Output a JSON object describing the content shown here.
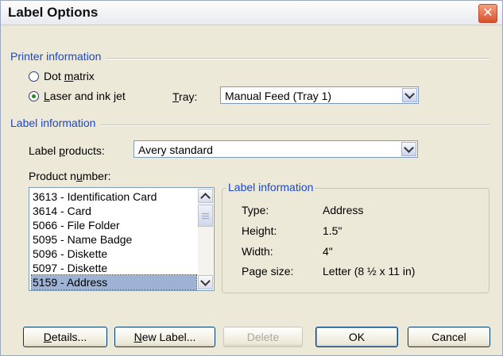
{
  "window": {
    "title": "Label Options",
    "close_glyph": "✕"
  },
  "printer": {
    "section_title": "Printer information",
    "dot_matrix": {
      "prefix": "Dot ",
      "hotkey": "m",
      "suffix": "atrix",
      "selected": false
    },
    "laser": {
      "prefix": "",
      "hotkey": "L",
      "suffix": "aser and ink jet",
      "selected": true
    },
    "tray_label": {
      "prefix": "",
      "hotkey": "T",
      "suffix": "ray:"
    },
    "tray_value": "Manual Feed (Tray 1)"
  },
  "label_info": {
    "section_title": "Label information",
    "products_label": {
      "prefix": "Label ",
      "hotkey": "p",
      "suffix": "roducts:"
    },
    "products_value": "Avery standard",
    "product_number_label": {
      "prefix": "Product n",
      "hotkey": "u",
      "suffix": "mber:"
    },
    "product_numbers": [
      "3613 - Identification Card",
      "3614 - Card",
      "5066 - File Folder",
      "5095 - Name Badge",
      "5096 - Diskette",
      "5097 - Diskette",
      "5159 - Address"
    ],
    "selected_product": "5159 - Address"
  },
  "details_box": {
    "title": "Label information",
    "rows": [
      {
        "key": "Type:",
        "value": "Address"
      },
      {
        "key": "Height:",
        "value": "1.5\""
      },
      {
        "key": "Width:",
        "value": "4\""
      },
      {
        "key": "Page size:",
        "value": "Letter (8 ½ x 11 in)"
      }
    ]
  },
  "buttons": {
    "details": {
      "prefix": "",
      "hotkey": "D",
      "suffix": "etails..."
    },
    "new_label": {
      "prefix": "",
      "hotkey": "N",
      "suffix": "ew Label..."
    },
    "delete": "Delete",
    "ok": "OK",
    "cancel": "Cancel"
  },
  "icons": {
    "dropdown": "chevron-down-icon",
    "scroll_up": "chevron-up-icon",
    "scroll_down": "chevron-down-icon",
    "close": "close-icon"
  }
}
